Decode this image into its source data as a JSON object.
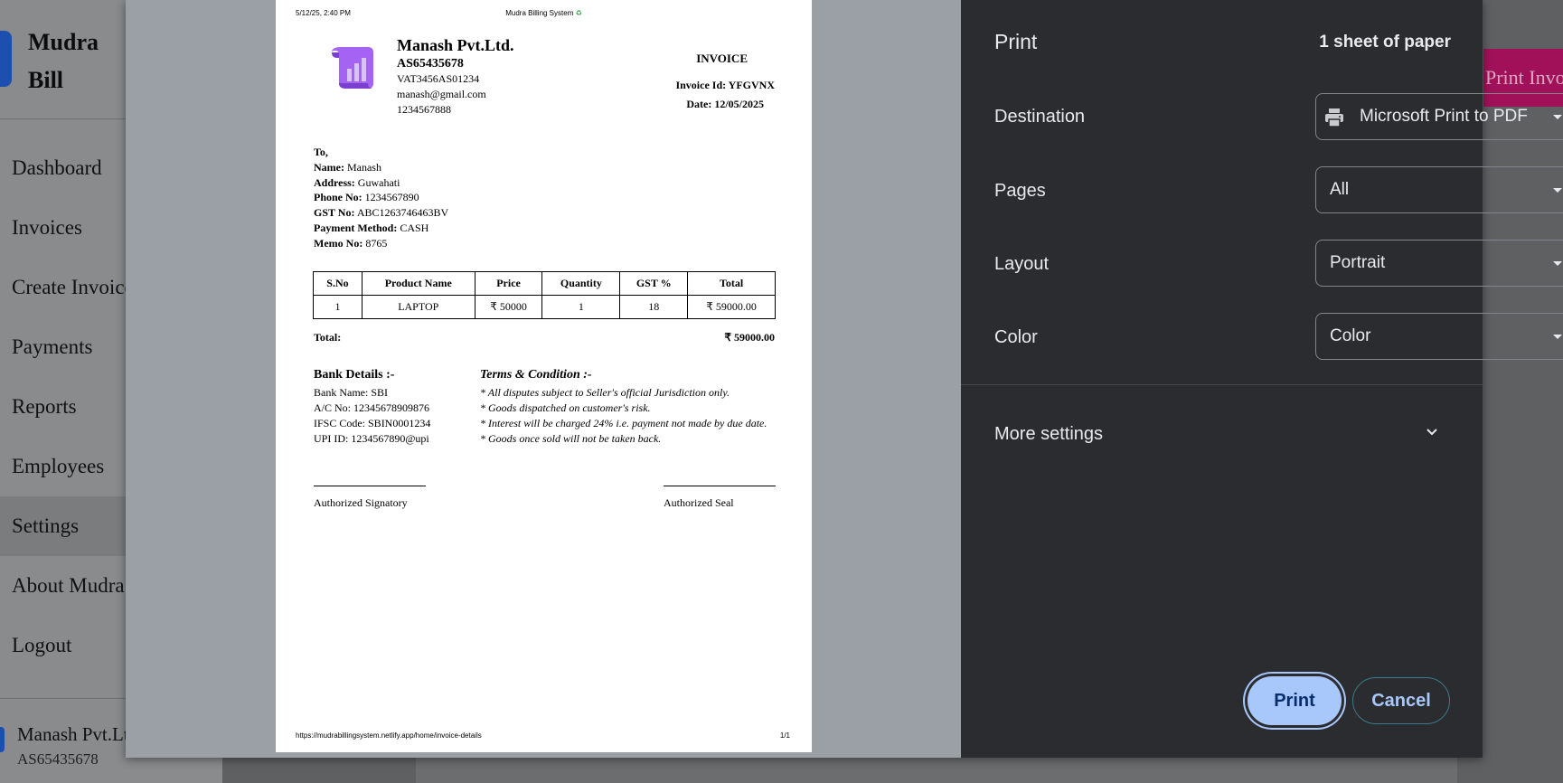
{
  "app": {
    "brand": [
      "Mudra",
      "Bill"
    ],
    "nav": [
      {
        "label": "Dashboard"
      },
      {
        "label": "Invoices"
      },
      {
        "label": "Create Invoice"
      },
      {
        "label": "Payments"
      },
      {
        "label": "Reports"
      },
      {
        "label": "Employees"
      },
      {
        "label": "Settings",
        "active": true
      },
      {
        "label": "About Mudra"
      },
      {
        "label": "Logout"
      }
    ],
    "user": {
      "name": "Manash Pvt.Ltd.",
      "id": "AS65435678"
    },
    "print_invoice_button": "Print Invoice"
  },
  "preview": {
    "header_datetime": "5/12/25, 2:40 PM",
    "header_title": "Mudra Billing System",
    "company": {
      "name": "Manash Pvt.Ltd.",
      "gst": "AS65435678",
      "vat": "VAT3456AS01234",
      "email": "manash@gmail.com",
      "phone": "1234567888"
    },
    "invoice": {
      "title": "INVOICE",
      "id_label": "Invoice Id:",
      "id": "YFGVNX",
      "date_label": "Date:",
      "date": "12/05/2025"
    },
    "customer": {
      "to": "To,",
      "fields": [
        {
          "label": "Name:",
          "value": "Manash"
        },
        {
          "label": "Address:",
          "value": "Guwahati"
        },
        {
          "label": "Phone No:",
          "value": "1234567890"
        },
        {
          "label": "GST No:",
          "value": "ABC1263746463BV"
        },
        {
          "label": "Payment Method:",
          "value": "CASH"
        },
        {
          "label": "Memo No:",
          "value": "8765"
        }
      ]
    },
    "table": {
      "headers": [
        "S.No",
        "Product Name",
        "Price",
        "Quantity",
        "GST %",
        "Total"
      ],
      "rows": [
        [
          "1",
          "LAPTOP",
          "₹ 50000",
          "1",
          "18",
          "₹ 59000.00"
        ]
      ]
    },
    "total_label": "Total:",
    "total_value": "₹ 59000.00",
    "bank": {
      "heading": "Bank Details :-",
      "lines": [
        "Bank Name: SBI",
        "A/C No: 12345678909876",
        "IFSC Code: SBIN0001234",
        "UPI ID: 1234567890@upi"
      ]
    },
    "terms": {
      "heading": "Terms & Condition :-",
      "lines": [
        "* All disputes subject to Seller's official Jurisdiction only.",
        "* Goods dispatched on customer's risk.",
        "* Interest will be charged 24% i.e. payment not made by due date.",
        "* Goods once sold will not be taken back."
      ]
    },
    "signatory": "Authorized Signatory",
    "seal": "Authorized Seal",
    "footer_url": "https://mudrabillingsystem.netlify.app/home/invoice-details",
    "footer_page": "1/1"
  },
  "print_settings": {
    "title": "Print",
    "sheets": "1 sheet of paper",
    "destination": {
      "label": "Destination",
      "value": "Microsoft Print to PDF"
    },
    "pages": {
      "label": "Pages",
      "value": "All"
    },
    "layout": {
      "label": "Layout",
      "value": "Portrait"
    },
    "color": {
      "label": "Color",
      "value": "Color"
    },
    "more_settings": "More settings",
    "print_button": "Print",
    "cancel_button": "Cancel"
  },
  "colors": {
    "print_button_bg": "#a8c7fa",
    "dialog_bg": "#2b2c2f",
    "brand_blue": "#1d4fb0",
    "print_invoice_bg": "#a0115a",
    "logo_purple": "#a463f2"
  },
  "icons": {
    "logo": "scroll-chart-icon",
    "printer": "printer-icon",
    "chevron": "chevron-down-icon",
    "caret": "caret-down-icon",
    "recycle": "recycle-icon"
  }
}
